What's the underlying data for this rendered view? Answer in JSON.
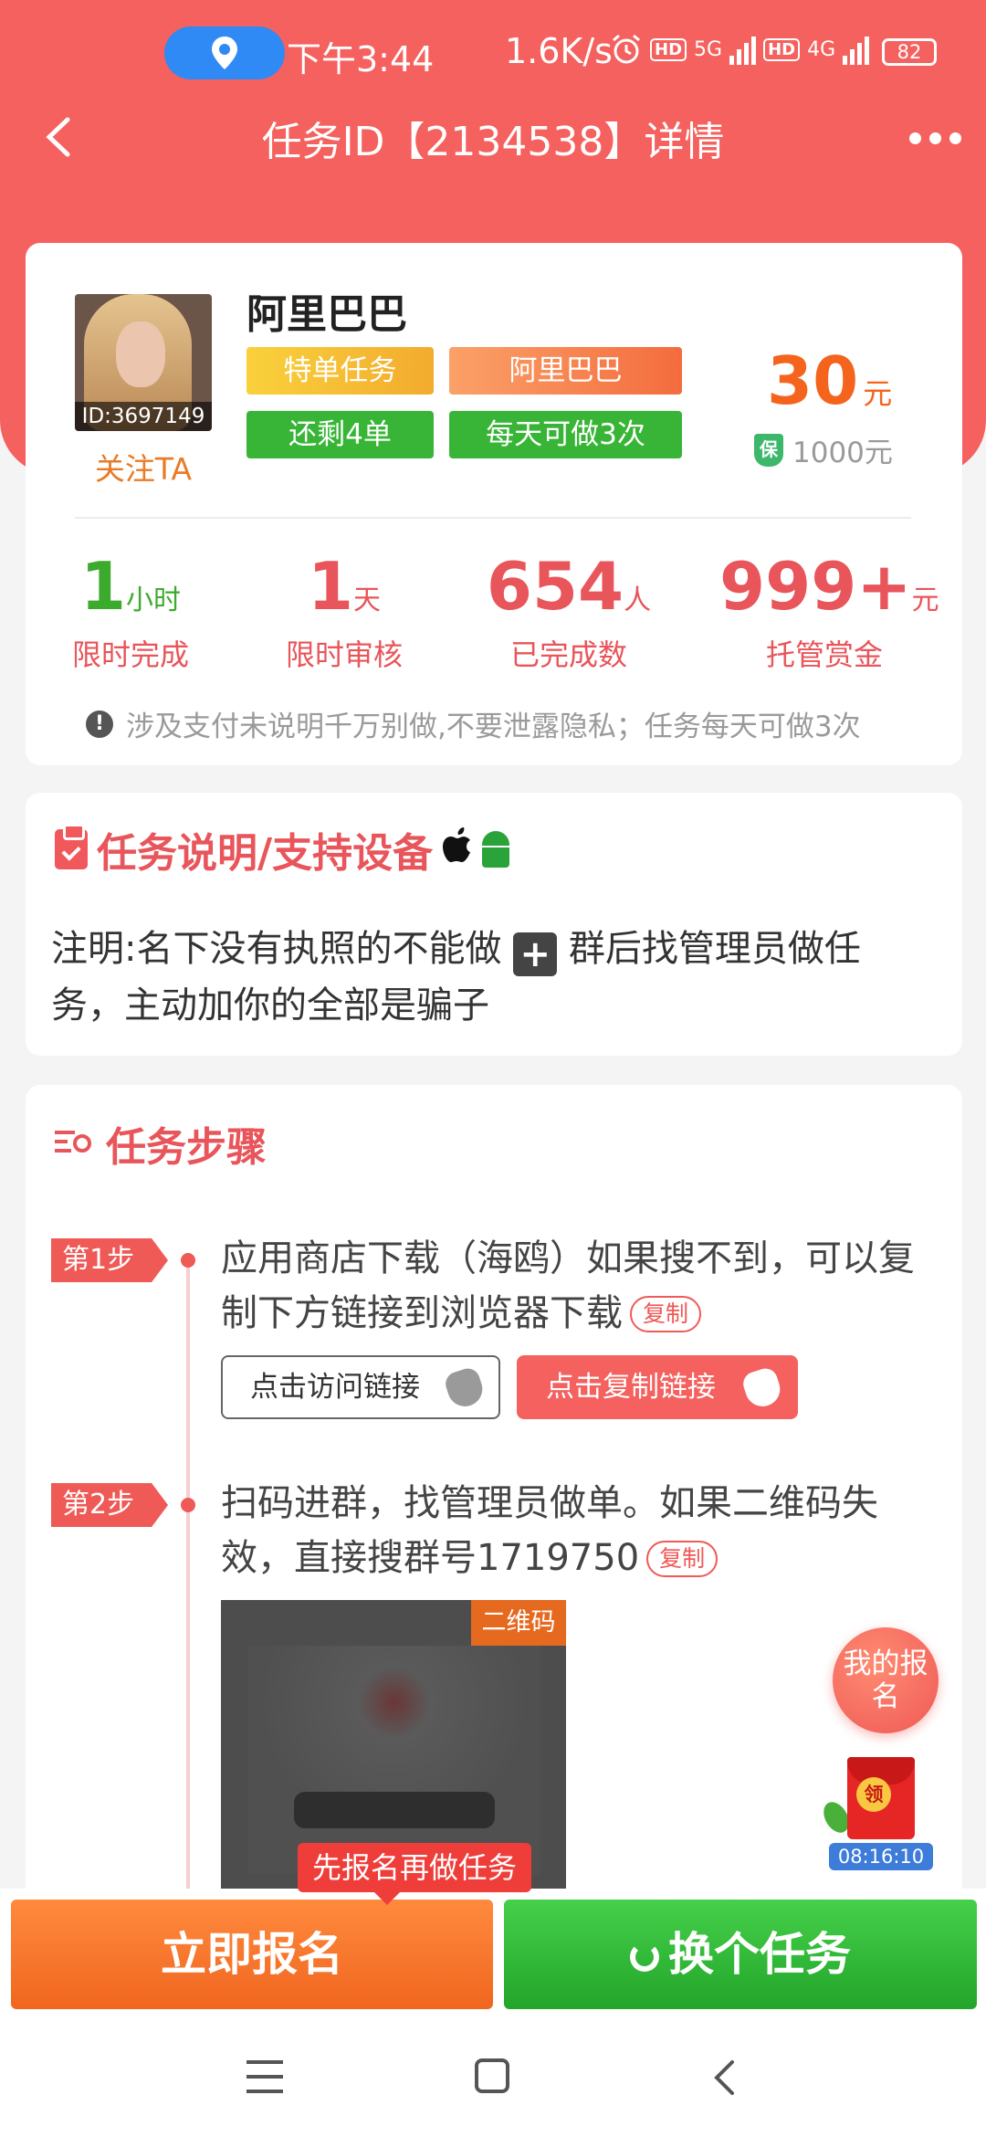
{
  "status_bar": {
    "time": "下午3:44",
    "net_speed": "1.6K/s",
    "signal_5g": "5G",
    "signal_4g": "4G",
    "hd": "HD",
    "battery": "82",
    "icons": [
      "location-icon",
      "alarm-icon",
      "signal-icon",
      "battery-icon"
    ]
  },
  "header": {
    "title": "任务ID【2134538】详情"
  },
  "publisher": {
    "name": "阿里巴巴",
    "avatar_id": "ID:3697149",
    "follow_label": "关注TA",
    "tags": [
      "特单任务",
      "阿里巴巴",
      "还剩4单",
      "每天可做3次"
    ],
    "reward": "30",
    "reward_unit": "元",
    "guarantee": "1000元",
    "guarantee_badge": "保"
  },
  "stats": [
    {
      "value": "1",
      "unit": "小时",
      "label": "限时完成"
    },
    {
      "value": "1",
      "unit": "天",
      "label": "限时审核"
    },
    {
      "value": "654",
      "unit": "人",
      "label": "已完成数"
    },
    {
      "value": "999+",
      "unit": "元",
      "label": "托管赏金"
    }
  ],
  "notice": "涉及支付未说明千万别做,不要泄露隐私；任务每天可做3次",
  "description": {
    "title": "任务说明/支持设备",
    "text_before": "注明:名下没有执照的不能做",
    "text_after": "群后找管理员做任务，主动加你的全部是骗子"
  },
  "steps": {
    "title": "任务步骤",
    "items": [
      {
        "label": "第1步",
        "text": "应用商店下载（海鸥）如果搜不到，可以复制下方链接到浏览器下载",
        "copy_label": "复制",
        "visit_button": "点击访问链接",
        "copy_button": "点击复制链接"
      },
      {
        "label": "第2步",
        "text": "扫码进群，找管理员做单。如果二维码失效，直接搜群号1719750",
        "copy_label": "复制",
        "qr_tag": "二维码"
      }
    ]
  },
  "floating": {
    "my_signup": "我的报名",
    "redpacket_label": "领",
    "redpacket_timer": "08:16:10"
  },
  "bottom": {
    "tooltip": "先报名再做任务",
    "signup_button": "立即报名",
    "switch_button": "换个任务"
  },
  "colors": {
    "primary": "#f4615e",
    "green": "#38b537",
    "orange": "#f1661f"
  }
}
